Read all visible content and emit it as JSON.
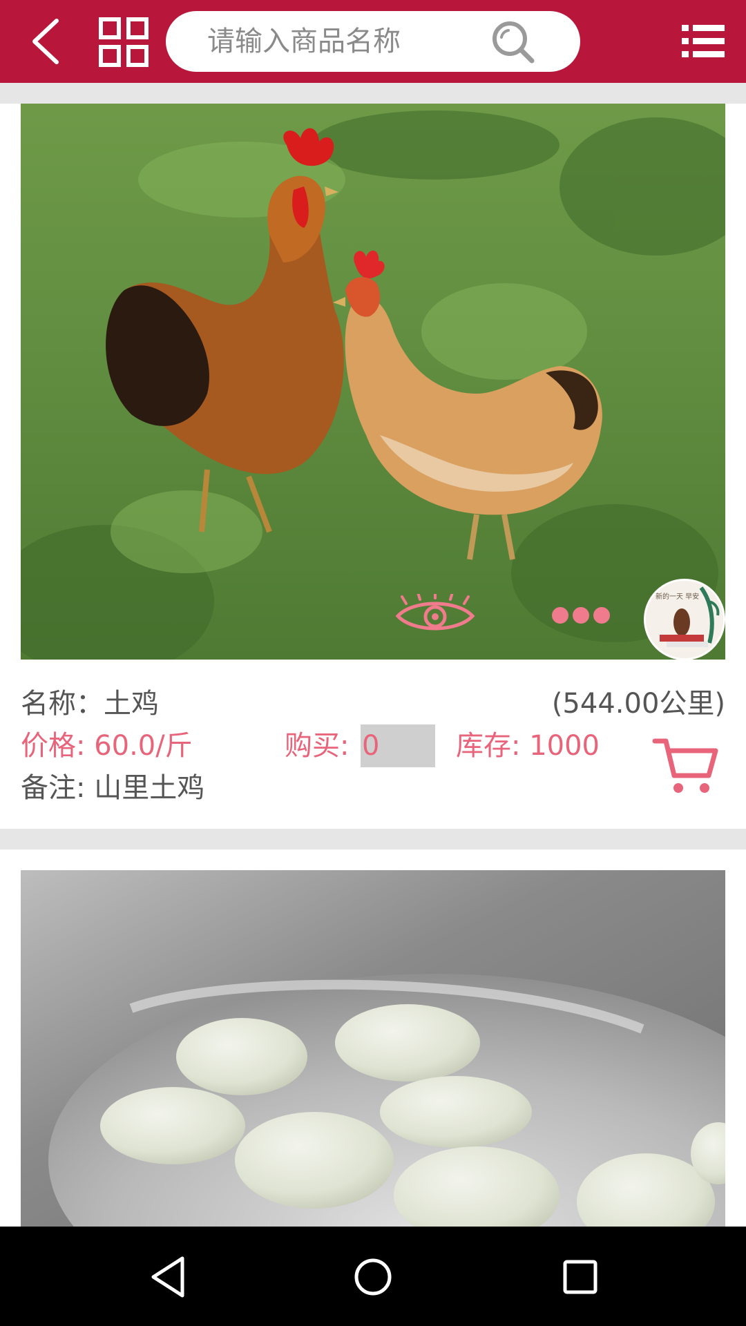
{
  "search": {
    "placeholder": "请输入商品名称"
  },
  "colors": {
    "brand": "#b8163a",
    "accent": "#e8647a",
    "divider": "#e6e6e6"
  },
  "icons": {
    "back": "back-arrow-icon",
    "grid": "grid-icon",
    "search": "search-icon",
    "menu": "list-menu-icon",
    "eye": "eye-icon",
    "more": "more-dots-icon",
    "cart": "cart-icon",
    "nav_back": "triangle-back-icon",
    "nav_home": "circle-home-icon",
    "nav_recents": "square-recents-icon"
  },
  "products": [
    {
      "name_line": "名称：土鸡",
      "distance": "(544.00公里)",
      "price_line": "价格: 60.0/斤",
      "buy_label": "购买:",
      "quantity": "0",
      "stock_line": "库存: 1000",
      "note_line": "备注: 山里土鸡",
      "avatar_text": "新的一天 早安"
    },
    {}
  ]
}
